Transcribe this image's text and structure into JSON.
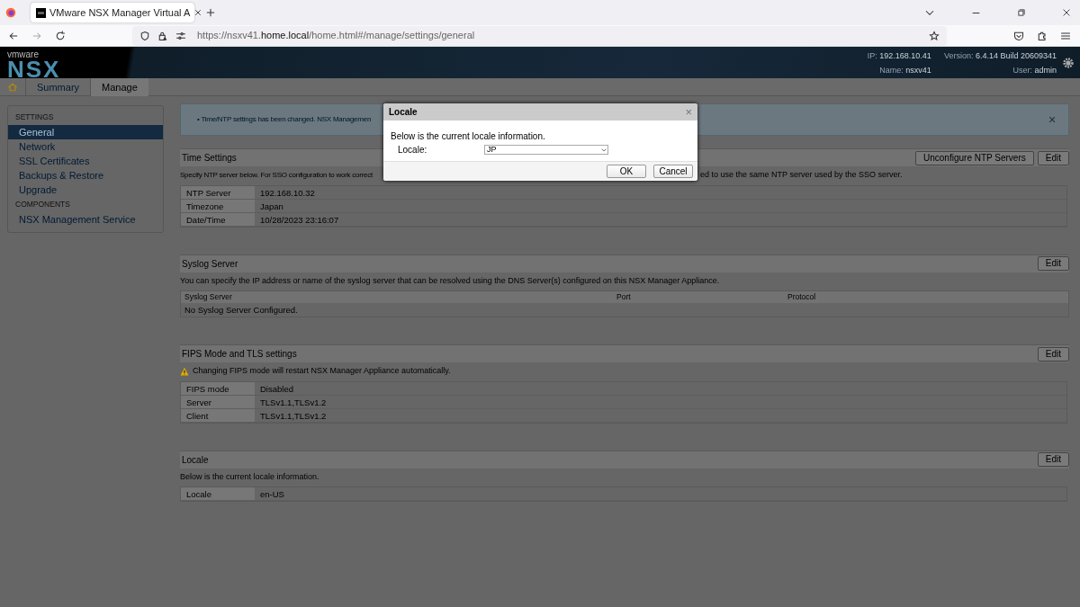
{
  "browser": {
    "tab_title": "VMware NSX Manager Virtual A",
    "url_prefix": "https://nsxv41.",
    "url_host": "home.local",
    "url_path": "/home.html#/manage/settings/general"
  },
  "header": {
    "brand_small": "vmware",
    "brand": "NSX",
    "info": [
      {
        "label": "IP:",
        "value": "192.168.10.41"
      },
      {
        "label": "Version:",
        "value": "6.4.14 Build 20609341"
      },
      {
        "label": "Name:",
        "value": "nsxv41"
      },
      {
        "label": "User:",
        "value": "admin"
      }
    ]
  },
  "nav_tabs": [
    {
      "label": "Summary",
      "selected": false
    },
    {
      "label": "Manage",
      "selected": true
    }
  ],
  "sidebar": {
    "sections": [
      {
        "heading": "SETTINGS",
        "items": [
          {
            "label": "General",
            "selected": true
          },
          {
            "label": "Network",
            "selected": false
          },
          {
            "label": "SSL Certificates",
            "selected": false
          },
          {
            "label": "Backups & Restore",
            "selected": false
          },
          {
            "label": "Upgrade",
            "selected": false
          }
        ]
      },
      {
        "heading": "COMPONENTS",
        "items": [
          {
            "label": "NSX Management Service",
            "selected": false
          }
        ]
      }
    ]
  },
  "alert": {
    "text": "• Time/NTP settings has been changed. NSX Managemen",
    "close": "×"
  },
  "sections": [
    {
      "title": "Time Settings",
      "buttons": [
        "Unconfigure NTP Servers",
        "Edit"
      ],
      "description_parts": [
        "Specify NTP server below. For SSO configuration to work correct",
        "ed to use the same NTP server used by the SSO server."
      ],
      "properties": [
        {
          "label": "NTP Server",
          "value": "192.168.10.32"
        },
        {
          "label": "Timezone",
          "value": "Japan"
        },
        {
          "label": "Date/Time",
          "value": "10/28/2023 23:16:07"
        }
      ]
    },
    {
      "title": "Syslog Server",
      "buttons": [
        "Edit"
      ],
      "description_parts": [
        "You can specify the IP address or name of the syslog server that can be resolved using the DNS Server(s) configured on this NSX Manager Appliance."
      ],
      "table": {
        "columns": [
          "Syslog Server",
          "Port",
          "Protocol"
        ],
        "empty_text": "No Syslog Server Configured."
      }
    },
    {
      "title": "FIPS Mode and TLS settings",
      "buttons": [
        "Edit"
      ],
      "warning": "Changing FIPS mode will restart NSX Manager Appliance automatically.",
      "properties": [
        {
          "label": "FIPS mode",
          "value": "Disabled"
        },
        {
          "label": "Server",
          "value": "TLSv1.1,TLSv1.2"
        },
        {
          "label": "Client",
          "value": "TLSv1.1,TLSv1.2"
        }
      ]
    },
    {
      "title": "Locale",
      "buttons": [
        "Edit"
      ],
      "description_parts": [
        "Below is the current locale information."
      ],
      "properties": [
        {
          "label": "Locale",
          "value": "en-US"
        }
      ]
    }
  ],
  "modal": {
    "title": "Locale",
    "close": "×",
    "text": "Below is the current locale information.",
    "field_label": "Locale:",
    "field_value": "JP",
    "buttons": [
      "OK",
      "Cancel"
    ]
  }
}
